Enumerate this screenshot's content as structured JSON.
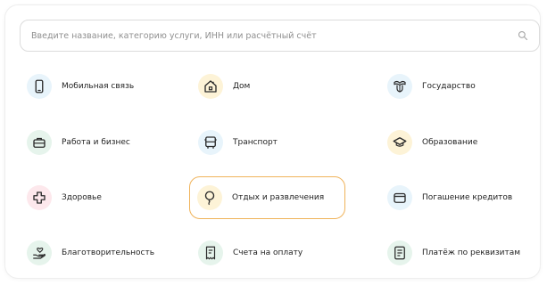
{
  "search": {
    "placeholder": "Введите название, категорию услуги, ИНН или расчётный счёт"
  },
  "categories": [
    {
      "label": "Мобильная связь",
      "icon": "mobile-phone-icon",
      "bg": "#e8f4fb",
      "fg": "#2b2b2b"
    },
    {
      "label": "Дом",
      "icon": "house-icon",
      "bg": "#fdf3d7",
      "fg": "#2b2b2b"
    },
    {
      "label": "Государство",
      "icon": "state-emblem-icon",
      "bg": "#e8f4fb",
      "fg": "#2b2b2b"
    },
    {
      "label": "Работа и бизнес",
      "icon": "briefcase-icon",
      "bg": "#e6f4ec",
      "fg": "#2b2b2b"
    },
    {
      "label": "Транспорт",
      "icon": "bus-icon",
      "bg": "#e8f4fb",
      "fg": "#2b2b2b"
    },
    {
      "label": "Образование",
      "icon": "graduation-cap-icon",
      "bg": "#fdf3d7",
      "fg": "#2b2b2b"
    },
    {
      "label": "Здоровье",
      "icon": "medical-cross-icon",
      "bg": "#fde8ec",
      "fg": "#2b2b2b"
    },
    {
      "label": "Отдых и развлечения",
      "icon": "balloon-icon",
      "bg": "#fdf3d7",
      "fg": "#2b2b2b"
    },
    {
      "label": "Погашение кредитов",
      "icon": "wallet-icon",
      "bg": "#e8f4fb",
      "fg": "#2b2b2b"
    },
    {
      "label": "Благотворительность",
      "icon": "charity-hand-icon",
      "bg": "#e6f4ec",
      "fg": "#2b2b2b"
    },
    {
      "label": "Счета на оплату",
      "icon": "bill-icon",
      "bg": "#e6f4ec",
      "fg": "#2b2b2b"
    },
    {
      "label": "Платёж по реквизитам",
      "icon": "details-document-icon",
      "bg": "#e6f4ec",
      "fg": "#2b2b2b"
    }
  ],
  "active_index": 7,
  "colors": {
    "active_border": "#f0b35a",
    "text": "#1f1f1f",
    "placeholder": "#8f8f8f"
  }
}
